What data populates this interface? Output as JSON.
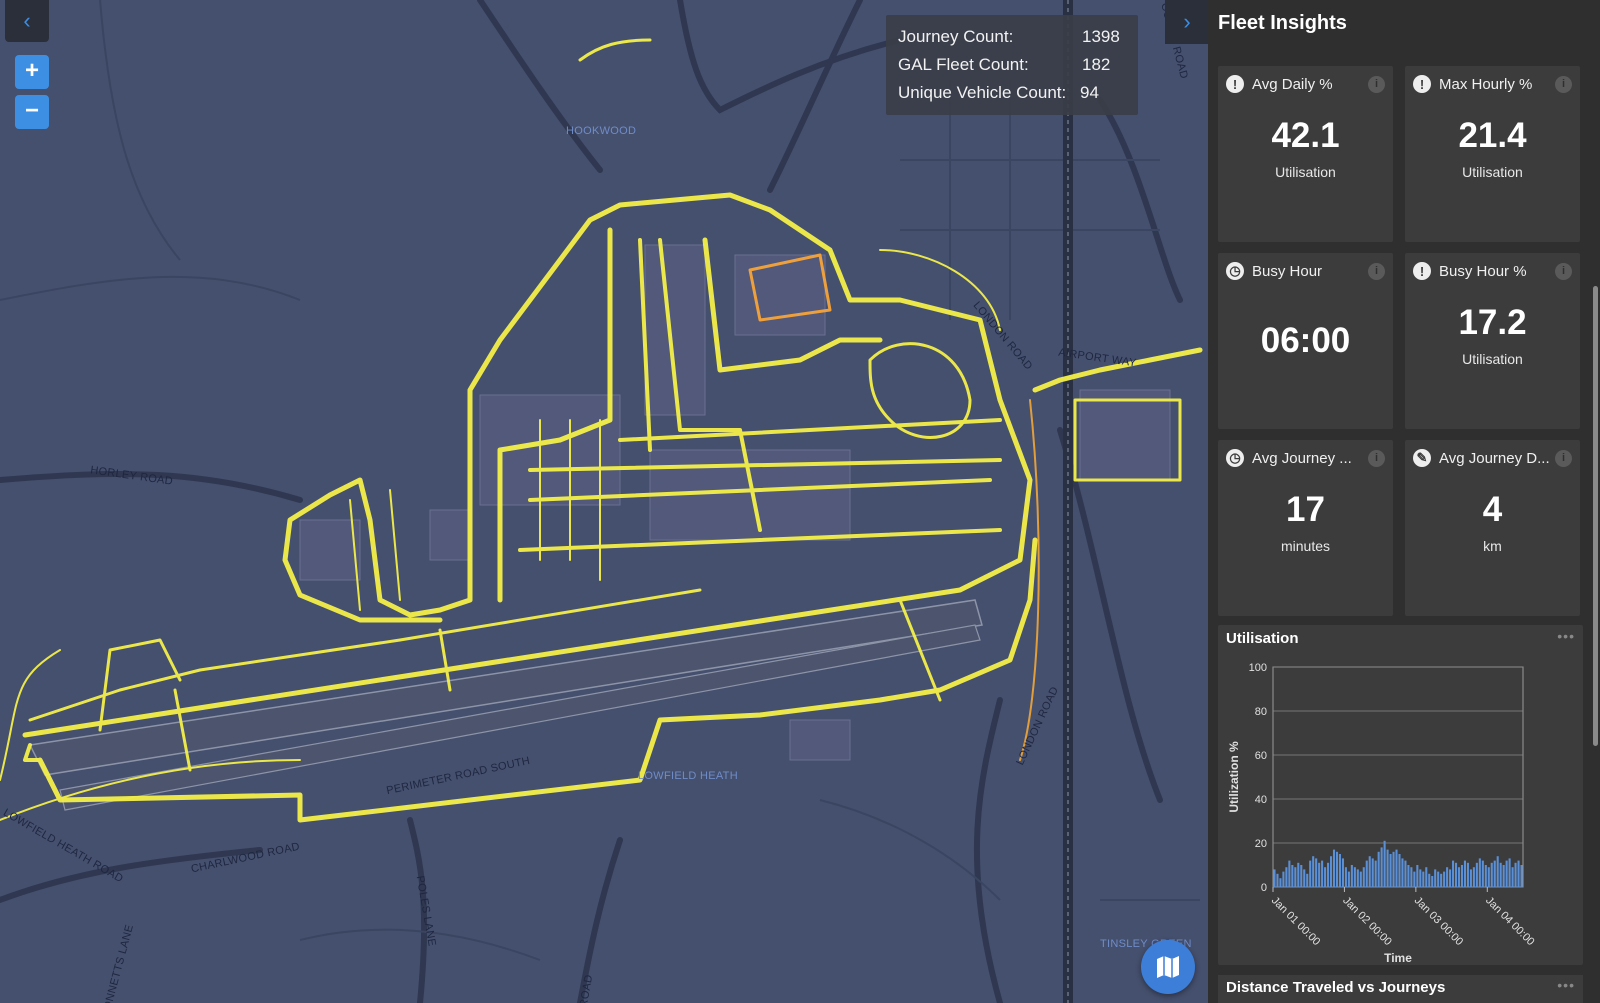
{
  "map": {
    "back_icon": "chevron-left-icon",
    "zoom_in_label": "+",
    "zoom_out_label": "−",
    "labels": {
      "hookwood": "HOOKWOOD",
      "horley_road": "HORLEY ROAD",
      "london_road_1": "LONDON ROAD",
      "airport_way": "AIRPORT WAY",
      "london_road_2": "LONDON ROAD",
      "lowfield_heath": "LOWFIELD HEATH",
      "perimeter_road_south": "PERIMETER ROAD SOUTH",
      "charlwood_road": "CHARLWOOD ROAD",
      "lowfield_heath_road": "LOWFIELD HEATH ROAD",
      "poles_lane": "POLES LANE",
      "tinsley_green": "TINSLEY GREEN",
      "bonnetts_lane": "BONNETTS LANE",
      "road": "ROAD",
      "balcombe_road": "COMBE ROAD"
    },
    "colors": {
      "background": "#45506e",
      "tracks": "#f4f04a",
      "accent": "#3d8fe3"
    },
    "layers_icon": "map-icon"
  },
  "stats": {
    "journey_count_label": "Journey Count:",
    "journey_count": "1398",
    "fleet_count_label": "GAL Fleet Count:",
    "fleet_count": "182",
    "unique_vehicle_label": "Unique Vehicle Count:",
    "unique_vehicle": "94"
  },
  "panel": {
    "collapse_icon": "chevron-right-icon",
    "title": "Fleet Insights",
    "cards": [
      {
        "icon": "thermometer-icon",
        "glyph": "!",
        "title": "Avg Daily %",
        "value": "42.1",
        "unit": "Utilisation"
      },
      {
        "icon": "thermometer-icon",
        "glyph": "!",
        "title": "Max Hourly %",
        "value": "21.4",
        "unit": "Utilisation"
      },
      {
        "icon": "clock-icon",
        "glyph": "◷",
        "title": "Busy Hour",
        "value": "06:00",
        "unit": ""
      },
      {
        "icon": "thermometer-icon",
        "glyph": "!",
        "title": "Busy Hour %",
        "value": "17.2",
        "unit": "Utilisation"
      },
      {
        "icon": "clock-icon",
        "glyph": "◷",
        "title": "Avg Journey ...",
        "value": "17",
        "unit": "minutes"
      },
      {
        "icon": "ruler-icon",
        "glyph": "✎",
        "title": "Avg Journey D...",
        "value": "4",
        "unit": "km"
      }
    ],
    "info_glyph": "i",
    "more_glyph": "•••",
    "chart2_title": "Distance Traveled vs Journeys"
  },
  "chart_data": {
    "type": "bar",
    "title": "Utilisation",
    "xlabel": "Time",
    "ylabel": "Utilization %",
    "ylim": [
      0,
      100
    ],
    "yticks": [
      0,
      20,
      40,
      60,
      80,
      100
    ],
    "xticks": [
      "Jan 01 00:00",
      "Jan 02 00:00",
      "Jan 03 00:00",
      "Jan 04 00:00"
    ],
    "grid": true,
    "color": "#5b8fd6",
    "x_start": "Jan 01 00:00",
    "x_step_hours": 1,
    "values": [
      8,
      6,
      4,
      7,
      9,
      12,
      10,
      9,
      11,
      10,
      8,
      6,
      12,
      14,
      13,
      11,
      12,
      9,
      11,
      14,
      17,
      16,
      15,
      13,
      9,
      7,
      10,
      9,
      8,
      7,
      9,
      12,
      14,
      13,
      12,
      16,
      18,
      21,
      17,
      15,
      16,
      17,
      15,
      13,
      12,
      10,
      9,
      7,
      10,
      8,
      7,
      9,
      6,
      5,
      8,
      7,
      6,
      7,
      9,
      8,
      12,
      11,
      9,
      10,
      12,
      11,
      8,
      9,
      11,
      13,
      12,
      10,
      9,
      11,
      12,
      14,
      11,
      10,
      12,
      13,
      9,
      11,
      12,
      10
    ]
  }
}
